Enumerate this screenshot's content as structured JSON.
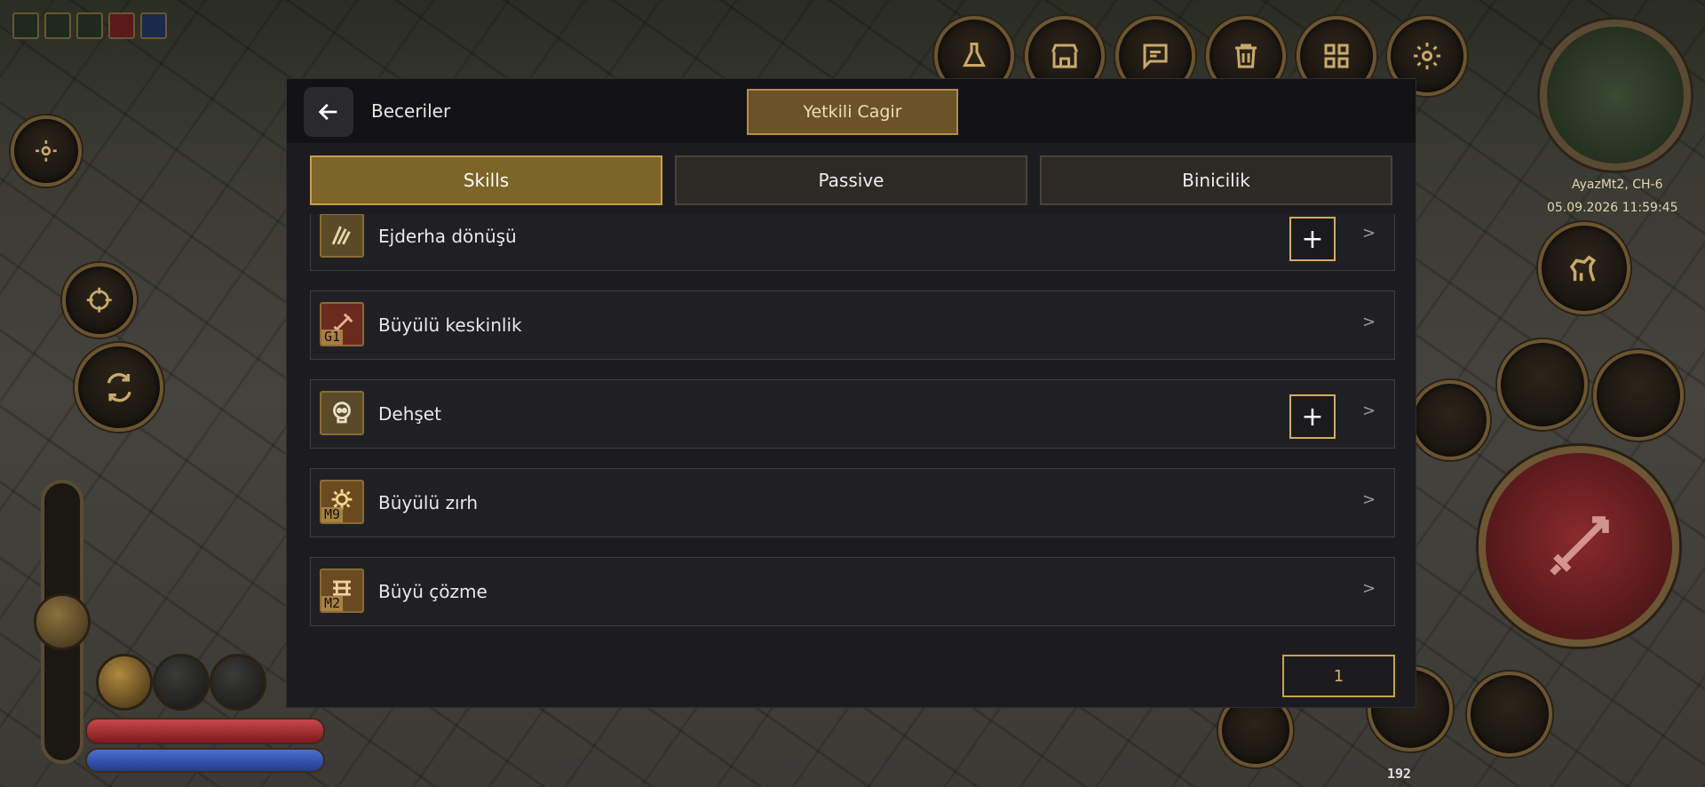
{
  "dialog": {
    "title": "Beceriler",
    "call_button": "Yetkili Cagir",
    "tabs": [
      {
        "label": "Skills",
        "active": true
      },
      {
        "label": "Passive",
        "active": false
      },
      {
        "label": "Binicilik",
        "active": false
      }
    ],
    "skills": [
      {
        "name": "Ejderha dönüşü",
        "badge": "",
        "upgradable": true,
        "icon": "dragon-claw-icon"
      },
      {
        "name": "Büyülü keskinlik",
        "badge": "G1",
        "upgradable": false,
        "icon": "enchanted-blade-icon"
      },
      {
        "name": "Dehşet",
        "badge": "",
        "upgradable": true,
        "icon": "skull-icon"
      },
      {
        "name": "Büyülü zırh",
        "badge": "M9",
        "upgradable": false,
        "icon": "magic-armor-icon"
      },
      {
        "name": "Büyü çözme",
        "badge": "M2",
        "upgradable": false,
        "icon": "dispel-icon"
      }
    ],
    "plus_symbol": "+",
    "chevron_symbol": ">",
    "page_number": "1"
  },
  "hud": {
    "server_channel": "AyazMt2, CH-6",
    "datetime": "05.09.2026 11:59:45",
    "level": "192",
    "colors": {
      "gold": "#c6a04d",
      "hp": "#c8474a",
      "mp": "#4b6fd0"
    }
  }
}
